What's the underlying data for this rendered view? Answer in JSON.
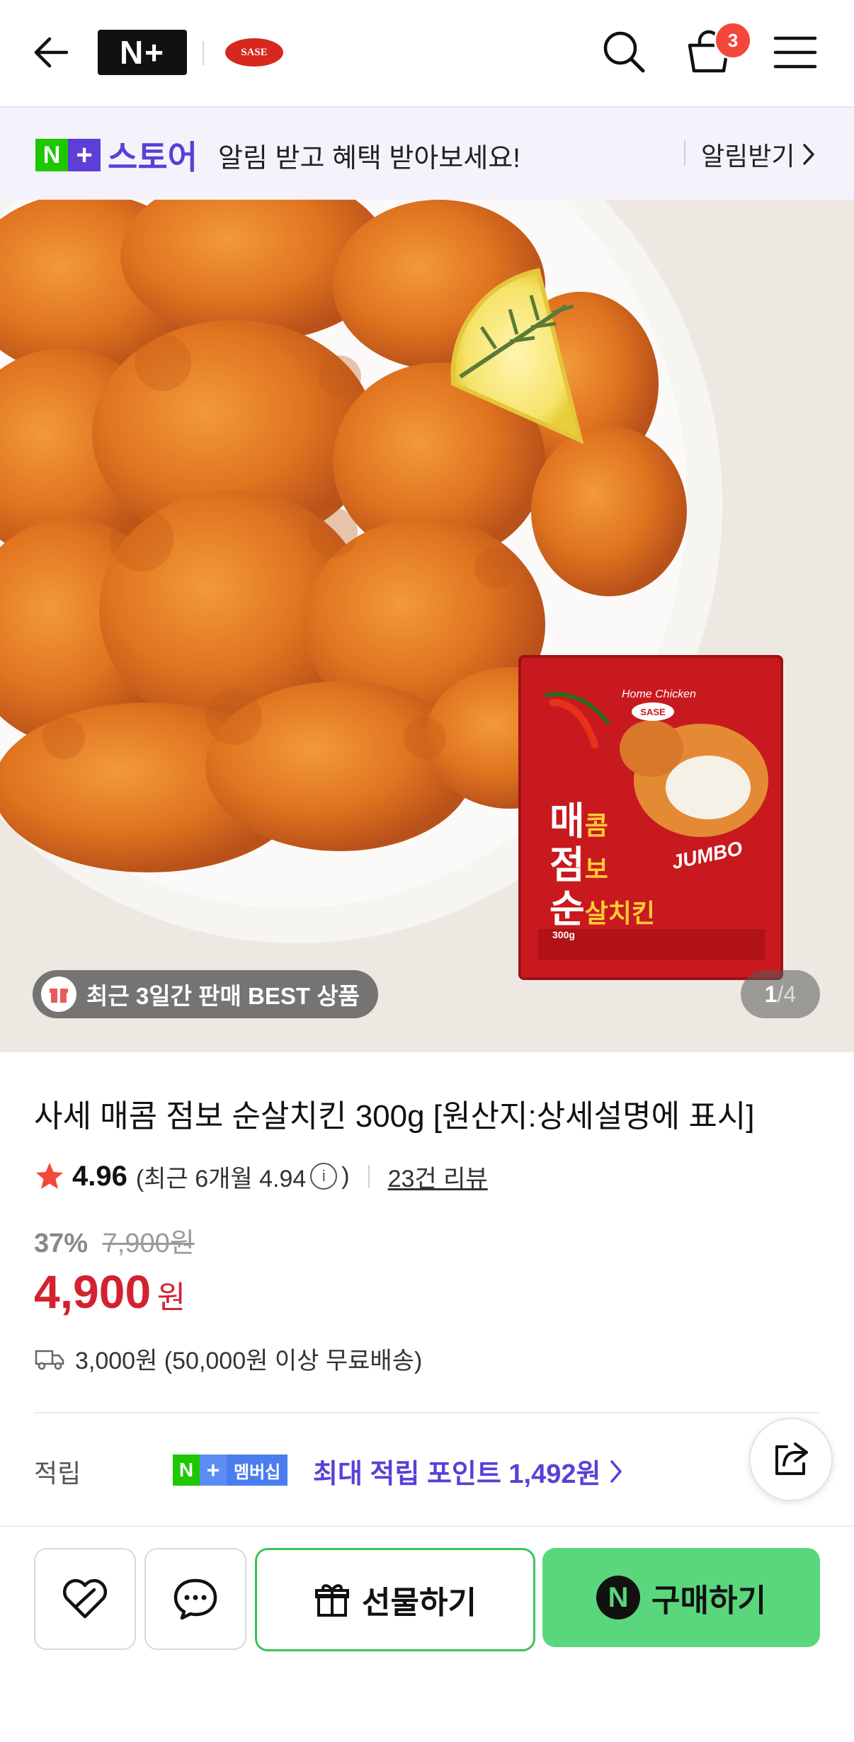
{
  "header": {
    "back_icon": "arrow-left-icon",
    "brand_logo": "N+",
    "store_logo": "SASE",
    "cart_count": "3",
    "colors": {
      "naver_green": "#1ec800",
      "purple": "#5b3fd6",
      "price_red": "#d3222f",
      "buy_green": "#5ad67d"
    }
  },
  "banner": {
    "store_label": "스토어",
    "message": "알림 받고 혜택 받아보세요!",
    "notify_label": "알림받기"
  },
  "hero": {
    "best_badge": "최근 3일간 판매 BEST 상품",
    "counter_current": "1",
    "counter_total": "/4",
    "package_brand": "SASE",
    "package_tag": "Home Chicken",
    "package_title_1": "매",
    "package_title_1b": "콤",
    "package_title_2": "점",
    "package_title_2b": "보",
    "package_title_3": "순",
    "package_title_3b": "살치킨",
    "package_jumbo": "JUMBO",
    "package_weight": "300g"
  },
  "product": {
    "title": "사세 매콤 점보 순살치킨 300g [원산지:상세설명에 표시]",
    "rating": "4.96",
    "recent_rating_prefix": "(최근 6개월 4.94",
    "recent_rating_suffix": ")",
    "review_count": "23건 리뷰",
    "discount_rate": "37%",
    "original_price": "7,900원",
    "price": "4,900",
    "price_unit": "원",
    "shipping": "3,000원 (50,000원 이상 무료배송)"
  },
  "points": {
    "label": "적립",
    "membership_n": "N",
    "membership_plus": "+",
    "membership_text": "멤버십",
    "text": "최대 적립 포인트 1,492원"
  },
  "bottom_bar": {
    "gift_label": "선물하기",
    "buy_label": "구매하기",
    "buy_badge": "N"
  }
}
